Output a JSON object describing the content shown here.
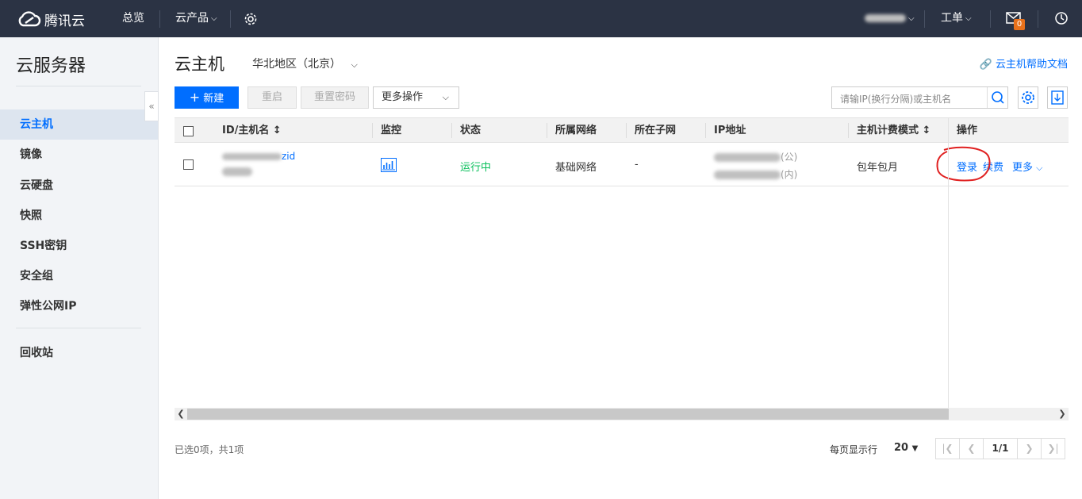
{
  "topbar": {
    "logo_text": "腾讯云",
    "overview": "总览",
    "products": "云产品",
    "ticket": "工单",
    "mail_badge": "0"
  },
  "sidebar": {
    "title": "云服务器",
    "items": [
      {
        "label": "云主机",
        "active": true
      },
      {
        "label": "镜像"
      },
      {
        "label": "云硬盘"
      },
      {
        "label": "快照"
      },
      {
        "label": "SSH密钥"
      },
      {
        "label": "安全组"
      },
      {
        "label": "弹性公网IP"
      },
      {
        "label": "回收站"
      }
    ]
  },
  "main": {
    "title": "云主机",
    "region": "华北地区（北京）",
    "help_link": "云主机帮助文档",
    "buttons": {
      "new": "新建",
      "restart": "重启",
      "reset_password": "重置密码",
      "more_actions": "更多操作"
    },
    "search_placeholder": "请输IP(换行分隔)或主机名"
  },
  "table": {
    "columns": [
      "ID/主机名",
      "监控",
      "状态",
      "所属网络",
      "所在子网",
      "IP地址",
      "主机计费模式",
      "操作"
    ],
    "rows": [
      {
        "id_fragment": "zid",
        "status": "运行中",
        "network": "基础网络",
        "subnet": "-",
        "ip_public_suffix": "(公)",
        "ip_private_suffix": "(内)",
        "billing": "包年包月",
        "actions": [
          "登录",
          "续费",
          "更多"
        ]
      }
    ]
  },
  "footer": {
    "selection": "已选0项，共1项",
    "per_page_label": "每页显示行",
    "per_page_value": "20",
    "page": "1/1"
  },
  "colors": {
    "topbar_bg": "#2b3344",
    "primary": "#006eff",
    "running": "#0abf5b",
    "badge": "#e8711b",
    "annotation": "#e02020"
  }
}
